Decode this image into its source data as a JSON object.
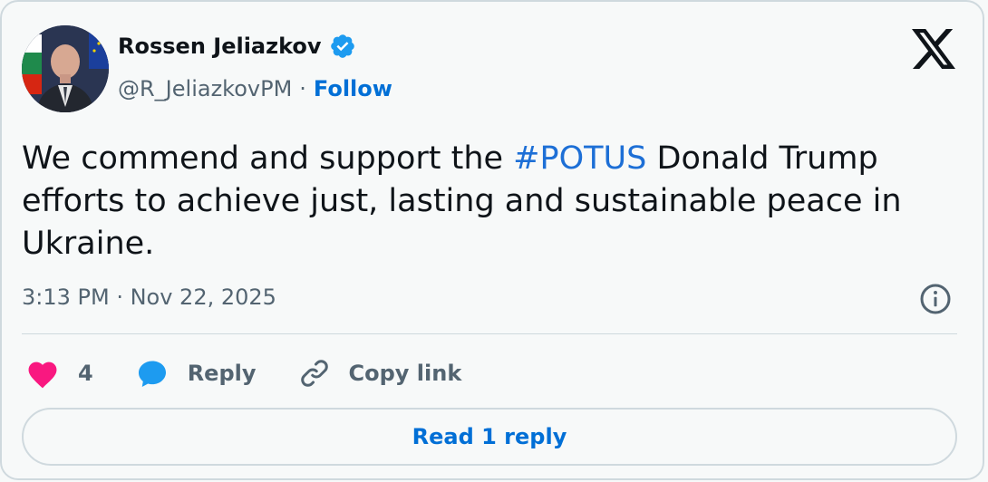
{
  "author": {
    "name": "Rossen Jeliazkov",
    "handle": "@R_JeliazkovPM",
    "separator": "·",
    "follow_label": "Follow"
  },
  "tweet": {
    "text_before": "We commend and support the ",
    "hashtag": "#POTUS",
    "text_after": " Donald Trump efforts to achieve just, lasting and sustainable peace in Ukraine.",
    "timestamp": "3:13 PM · Nov 22, 2025"
  },
  "actions": {
    "like_count": "4",
    "reply_label": "Reply",
    "copy_link_label": "Copy link"
  },
  "read_replies_label": "Read 1 reply",
  "colors": {
    "accent": "#006fd6",
    "like": "#f91880",
    "reply_icon": "#1d9bf0",
    "secondary_text": "#536471",
    "border": "#cfd9de"
  },
  "icons": {
    "brand": "x-logo-icon",
    "verified": "verified-badge-icon",
    "info": "info-icon",
    "like": "heart-icon",
    "reply": "speech-bubble-icon",
    "copy_link": "link-icon"
  }
}
